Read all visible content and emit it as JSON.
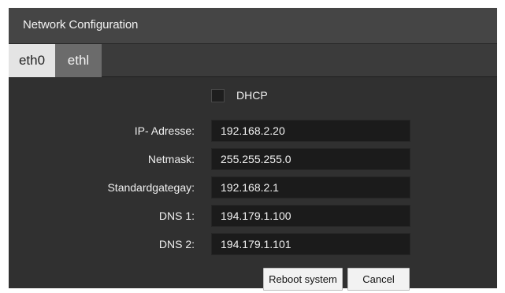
{
  "dialog": {
    "title": "Network Configuration"
  },
  "tabs": [
    {
      "label": "eth0",
      "active": true
    },
    {
      "label": "ethl",
      "active": false
    }
  ],
  "dhcp": {
    "label": "DHCP",
    "checked": false
  },
  "fields": {
    "ip": {
      "label": "IP- Adresse:",
      "value": "192.168.2.20"
    },
    "netmask": {
      "label": "Netmask:",
      "value": "255.255.255.0"
    },
    "gateway": {
      "label": "Standardgategay:",
      "value": "192.168.2.1"
    },
    "dns1": {
      "label": "DNS 1:",
      "value": "194.179.1.100"
    },
    "dns2": {
      "label": "DNS 2:",
      "value": "194.179.1.101"
    }
  },
  "buttons": {
    "reboot": "Reboot system",
    "cancel": "Cancel"
  },
  "colors": {
    "dialog_bg": "#303030",
    "titlebar_bg": "#454545",
    "active_tab_bg": "#e4e4e4",
    "inactive_tab_bg": "#6b6b6b",
    "input_bg": "#1b1b1b",
    "button_bg": "#f2f2f2"
  }
}
